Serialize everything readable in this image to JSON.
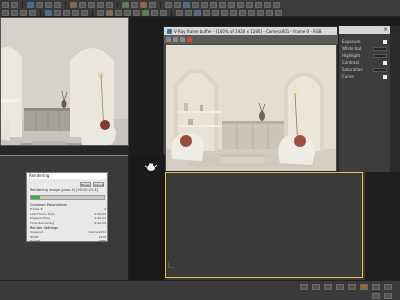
{
  "render_window": {
    "title": "V-Ray frame buffer - [100% of 1920 x 1280] - Camera001 - frame 0 - RGB"
  },
  "progress_dialog": {
    "title": "Rendering",
    "pause_label": "Pause",
    "cancel_label": "Cancel",
    "status_text": "Rendering image (pass 4)  [00:00:23.4]",
    "progress_pct": 12,
    "section_title": "Common Parameters",
    "fields": [
      {
        "label": "Frame #",
        "value": "0"
      },
      {
        "label": "Last Frame Time",
        "value": "0:00:00"
      },
      {
        "label": "Elapsed Time",
        "value": "0:00:24"
      },
      {
        "label": "Time Remaining",
        "value": "0:00:00"
      }
    ],
    "section2_title": "Render Settings",
    "fields2": [
      {
        "label": "Viewport",
        "value": "Camera001"
      },
      {
        "label": "Width",
        "value": "1920"
      },
      {
        "label": "Height",
        "value": "1280"
      }
    ]
  },
  "right_panel": {
    "close_label": "×",
    "rows": [
      "Exposure",
      "White bal.",
      "Highlight",
      "Contrast",
      "Saturation",
      "Curve"
    ]
  },
  "colors": {
    "progress": "#31b43a",
    "accent": "#e0c54a",
    "ui_dark": "#3a3a3a"
  }
}
